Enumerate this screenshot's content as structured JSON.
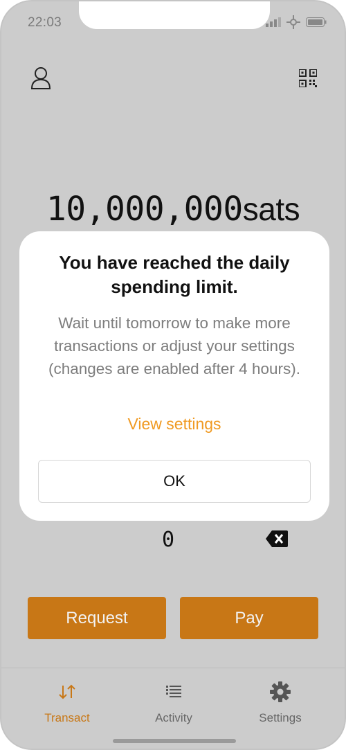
{
  "status_bar": {
    "time": "22:03",
    "icons": [
      "signal-icon",
      "network-icon",
      "battery-icon"
    ]
  },
  "header": {
    "left_icon": "user-icon",
    "right_icon": "qr-code-icon"
  },
  "amount": {
    "value": "10,000,000",
    "unit": "sats"
  },
  "keypad": {
    "zero": "0",
    "backspace_icon": "backspace-icon"
  },
  "actions": {
    "request_label": "Request",
    "pay_label": "Pay"
  },
  "tabs": [
    {
      "label": "Transact",
      "icon": "transfer-arrows-icon",
      "active": true
    },
    {
      "label": "Activity",
      "icon": "list-icon",
      "active": false
    },
    {
      "label": "Settings",
      "icon": "gear-icon",
      "active": false
    }
  ],
  "modal": {
    "title": "You have reached the daily spending limit.",
    "body": "Wait until tomorrow to make more transactions or adjust your settings (changes are enabled after 4 hours).",
    "link": "View settings",
    "ok_label": "OK"
  },
  "colors": {
    "accent": "#c87716",
    "link": "#f09a22",
    "background": "#cccccc"
  }
}
